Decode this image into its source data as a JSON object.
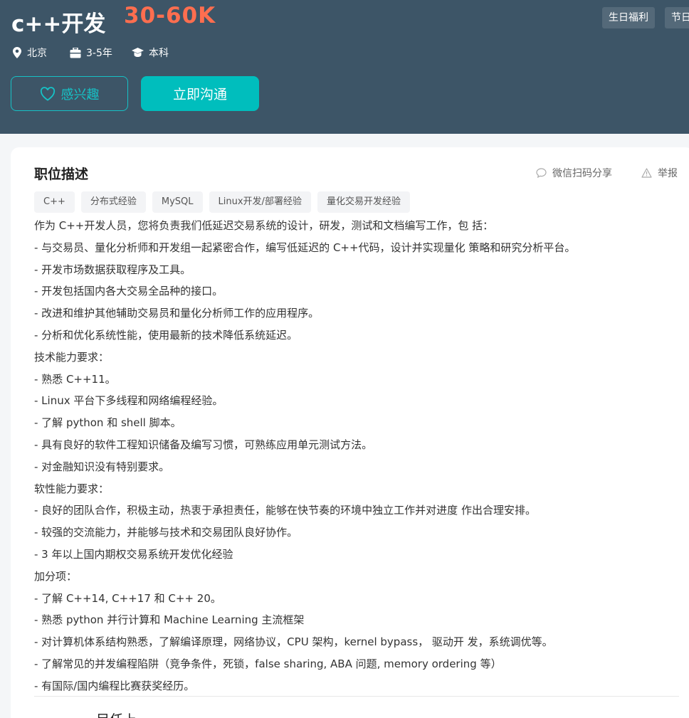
{
  "header": {
    "title": "c++开发",
    "salary": "30-60K",
    "benefits": [
      "生日福利",
      "节日"
    ],
    "meta": {
      "location": "北京",
      "experience": "3-5年",
      "education": "本科"
    },
    "interest_label": "感兴趣",
    "chat_label": "立即沟通"
  },
  "card": {
    "title": "职位描述",
    "share_label": "微信扫码分享",
    "report_label": "举报",
    "skills": [
      "C++",
      "分布式经验",
      "MySQL",
      "Linux开发/部署经验",
      "量化交易开发经验"
    ],
    "description": [
      "作为 C++开发人员，您将负责我们低延迟交易系统的设计，研发，测试和文档编写工作，包 括：",
      "- 与交易员、量化分析师和开发组一起紧密合作，编写低延迟的 C++代码，设计并实现量化 策略和研究分析平台。",
      "- 开发市场数据获取程序及工具。",
      "- 开发包括国内各大交易全品种的接口。",
      "- 改进和维护其他辅助交易员和量化分析师工作的应用程序。",
      "- 分析和优化系统性能，使用最新的技术降低系统延迟。",
      "技术能力要求：",
      "- 熟悉 C++11。",
      "- Linux 平台下多线程和网络编程经验。",
      "- 了解 python 和 shell 脚本。",
      "- 具有良好的软件工程知识储备及编写习惯，可熟练应用单元测试方法。",
      "- 对金融知识没有特别要求。",
      "软性能力要求：",
      "- 良好的团队合作，积极主动，热衷于承担责任，能够在快节奏的环境中独立工作并对进度 作出合理安排。",
      "- 较强的交流能力，并能够与技术和交易团队良好协作。",
      "- 3 年以上国内期权交易系统开发优化经验",
      "加分项：",
      "- 了解 C++14, C++17 和 C++ 20。",
      "- 熟悉 python 并行计算和 Machine Learning 主流框架",
      "- 对计算机体系结构熟悉，了解编译原理，网络协议，CPU 架构，kernel bypass， 驱动开 发，系统调优等。",
      "- 了解常见的并发编程陷阱（竞争条件，死锁，false sharing, ABA 问题, memory ordering 等）",
      "- 有国际/国内编程比赛获奖经历。"
    ],
    "next_section_partial": "目任上"
  },
  "colors": {
    "header_bg": "#3d5567",
    "salary": "#ff6e4f",
    "accent": "#00bebd"
  }
}
